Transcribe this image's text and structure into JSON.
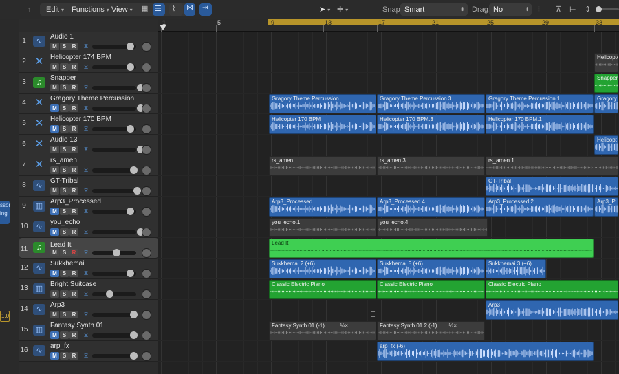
{
  "toolbar": {
    "edit": "Edit",
    "functions": "Functions",
    "view": "View",
    "snap_label": "Snap:",
    "snap_value": "Smart",
    "drag_label": "Drag:",
    "drag_value": "No Overlap"
  },
  "ruler": {
    "bars": [
      "1",
      "5",
      "9",
      "13",
      "17",
      "21",
      "25",
      "29",
      "33"
    ]
  },
  "inspector": {
    "fragments": [
      "ssor",
      "ing",
      "1.0"
    ]
  },
  "tracks": [
    {
      "num": "1",
      "name": "Audio 1",
      "icon": "waveform-icon"
    },
    {
      "num": "2",
      "name": "Helicopter 174 BPM",
      "icon": "drummer-icon"
    },
    {
      "num": "3",
      "name": "Snapper",
      "icon": "software-instrument-icon"
    },
    {
      "num": "4",
      "name": "Gragory Theme Percussion",
      "icon": "drummer-icon"
    },
    {
      "num": "5",
      "name": "Helicopter 170 BPM",
      "icon": "drummer-icon"
    },
    {
      "num": "6",
      "name": "Audio 13",
      "icon": "drummer-icon"
    },
    {
      "num": "7",
      "name": "rs_amen",
      "icon": "drummer-icon"
    },
    {
      "num": "8",
      "name": "GT-Tribal",
      "icon": "waveform-icon"
    },
    {
      "num": "9",
      "name": "Arp3_Processed",
      "icon": "keyboard-icon"
    },
    {
      "num": "10",
      "name": "you_echo",
      "icon": "waveform-icon"
    },
    {
      "num": "11",
      "name": "Lead It",
      "icon": "software-instrument-icon"
    },
    {
      "num": "12",
      "name": "Sukkhemai",
      "icon": "waveform-icon"
    },
    {
      "num": "13",
      "name": "Bright Suitcase",
      "icon": "keyboard-icon"
    },
    {
      "num": "14",
      "name": "Arp3",
      "icon": "waveform-icon"
    },
    {
      "num": "15",
      "name": "Fantasy Synth 01",
      "icon": "keyboard-icon"
    },
    {
      "num": "16",
      "name": "arp_fx",
      "icon": "waveform-icon"
    }
  ],
  "msr": {
    "m": "M",
    "s": "S",
    "r": "R"
  },
  "regions": {
    "heli174": "Helicopter",
    "snapper": "Snapper",
    "gragory1": "Gragory Theme Percussion",
    "gragory2": "Gragory Theme Percussion.3",
    "gragory3": "Gragory Theme Percussion.1",
    "gragory4": "Gragory T",
    "heli170a": "Helicopter 170 BPM",
    "heli170b": "Helicopter 170 BPM.3",
    "heli170c": "Helicopter 170 BPM.1",
    "heli6": "Helicopt",
    "amen1": "rs_amen",
    "amen2": "rs_amen.3",
    "amen3": "rs_amen.1",
    "tribal": "GT-Tribal",
    "arp1": "Arp3_Processed",
    "arp2": "Arp3_Processed.4",
    "arp3": "Arp3_Processed.2",
    "arp4": "Arp3_P",
    "echo1": "you_echo.1",
    "echo2": "you_echo.4",
    "leadit": "Lead It",
    "sukk1": "Sukkhemai.2 (+6)",
    "sukk2": "Sukkhemai.5 (+6)",
    "sukk3": "Sukkhemai.3 (+6)",
    "piano1": "Classic Electric Piano",
    "piano2": "Classic Electric Piano",
    "piano3": "Classic Electric Piano",
    "arp3b": "Arp3",
    "fantasy1": "Fantasy Synth 01 (-1)",
    "fantasy2": "Fantasy Synth 01.2 (-1)",
    "arpfx": "arp_fx (-6)"
  },
  "region_badges": {
    "fantasy": "½×"
  },
  "colors": {
    "accent_blue": "#2f66b0",
    "green": "#23a332",
    "cycle": "#b8952a"
  }
}
